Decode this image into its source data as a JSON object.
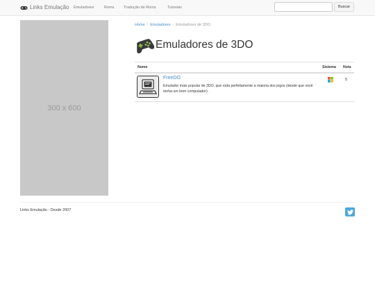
{
  "navbar": {
    "brand": "Links Emulação",
    "links": [
      "Emuladores",
      "Roms",
      "Tradução de Roms",
      "Tutoriais"
    ],
    "search_placeholder": "",
    "search_button": "Buscar"
  },
  "ad": {
    "label": "300 x 600"
  },
  "breadcrumb": [
    "Home",
    "Emuladores",
    "Emuladores de 3DO"
  ],
  "page_title": "Emuladores de 3DO",
  "table": {
    "headers": [
      "Nome",
      "Sistema",
      "Nota"
    ],
    "rows": [
      {
        "name": "FreeDO",
        "description": "Emulador mais popular de 3DO, que roda perfeitamente a maioria dos jogos (desde que você tenha um bom computador).",
        "system_icon": "windows-icon",
        "rating": "5"
      }
    ]
  },
  "footer": {
    "text": "Links Emulação - Desde 2007",
    "social_icon": "twitter-icon"
  },
  "colors": {
    "link": "#428bca",
    "twitter": "#4aa8de",
    "ad_bg": "#c8c8c8"
  }
}
